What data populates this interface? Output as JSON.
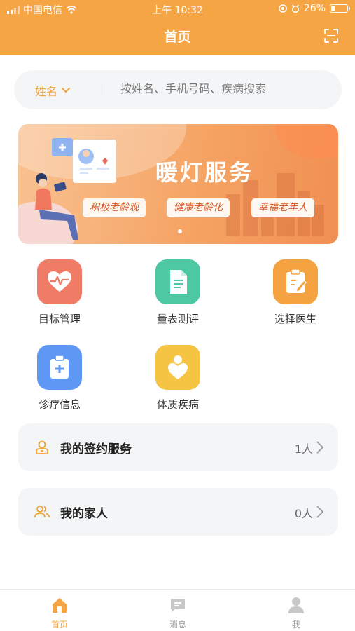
{
  "status_bar": {
    "carrier": "中国电信",
    "time": "上午 10:32",
    "battery": "26%",
    "battery_level": 0.26
  },
  "nav": {
    "title": "首页",
    "scan_icon": "scan-icon"
  },
  "search": {
    "filter_label": "姓名",
    "placeholder": "按姓名、手机号码、疾病搜索"
  },
  "banner": {
    "title": "暖灯服务",
    "tags": [
      "积极老龄观",
      "健康老龄化",
      "幸福老年人"
    ]
  },
  "features": [
    {
      "label": "目标管理",
      "icon": "heartbeat-icon",
      "color": "#f07b66"
    },
    {
      "label": "量表测评",
      "icon": "document-icon",
      "color": "#4cc8a3"
    },
    {
      "label": "选择医生",
      "icon": "clipboard-edit-icon",
      "color": "#f5a340"
    },
    {
      "label": "诊疗信息",
      "icon": "medical-kit-icon",
      "color": "#5f97f5"
    },
    {
      "label": "体质疾病",
      "icon": "person-heart-icon",
      "color": "#f6c443"
    }
  ],
  "cards": [
    {
      "title": "我的签约服务",
      "count": "1人",
      "icon": "person-badge-icon"
    },
    {
      "title": "我的家人",
      "count": "0人",
      "icon": "family-icon"
    }
  ],
  "tabs": [
    {
      "label": "首页",
      "icon": "home-icon",
      "active": true
    },
    {
      "label": "消息",
      "icon": "message-icon",
      "active": false
    },
    {
      "label": "我",
      "icon": "user-icon",
      "active": false
    }
  ],
  "colors": {
    "primary": "#f5a544",
    "inactive": "#c8c8c8"
  }
}
